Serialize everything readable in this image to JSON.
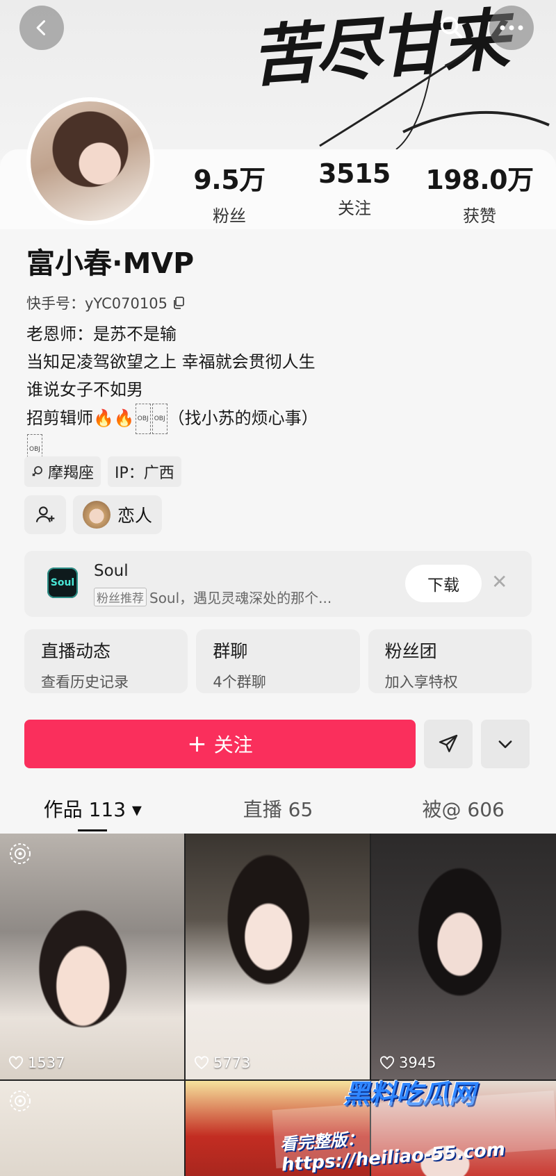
{
  "banner": {
    "calligraphy": "苦尽甘来"
  },
  "profile": {
    "name": "富小春·MVP",
    "uid_label": "快手号：yYC070105",
    "stats": [
      {
        "value": "9.5万",
        "label": "粉丝"
      },
      {
        "value": "3515",
        "label": "关注"
      },
      {
        "value": "198.0万",
        "label": "获赞"
      }
    ],
    "bio": {
      "line1": "老恩师：是苏不是输",
      "line2": "当知足凌驾欲望之上 幸福就会贯彻人生",
      "line3": "谁说女子不如男",
      "line4_prefix": "招剪辑师🔥🔥",
      "obj_text": "OBJ",
      "line4_suffix": "（找小苏的烦心事）"
    },
    "tags": {
      "zodiac": "摩羯座",
      "ip": "IP：广西"
    },
    "relation_label": "恋人"
  },
  "ad": {
    "logo_text": "Soul",
    "title": "Soul",
    "badge": "粉丝推荐",
    "subtitle": "Soul，遇见灵魂深处的那个...",
    "download": "下载",
    "close": "✕"
  },
  "features": [
    {
      "title": "直播动态",
      "sub": "查看历史记录"
    },
    {
      "title": "群聊",
      "sub": "4个群聊"
    },
    {
      "title": "粉丝团",
      "sub": "加入享特权"
    }
  ],
  "actions": {
    "follow": "关注",
    "plus": "+"
  },
  "tabs": [
    {
      "label": "作品 113 ▾"
    },
    {
      "label": "直播 65"
    },
    {
      "label": "被@ 606"
    }
  ],
  "videos": [
    {
      "likes": "1537"
    },
    {
      "likes": "5773"
    },
    {
      "likes": "3945"
    }
  ],
  "watermark": {
    "site_name": "黑料吃瓜网",
    "label": "看完整版：",
    "url": "https://heiliao-55.com"
  },
  "colors": {
    "follow": "#fa2f5c",
    "soul_accent": "#49e6d6"
  }
}
